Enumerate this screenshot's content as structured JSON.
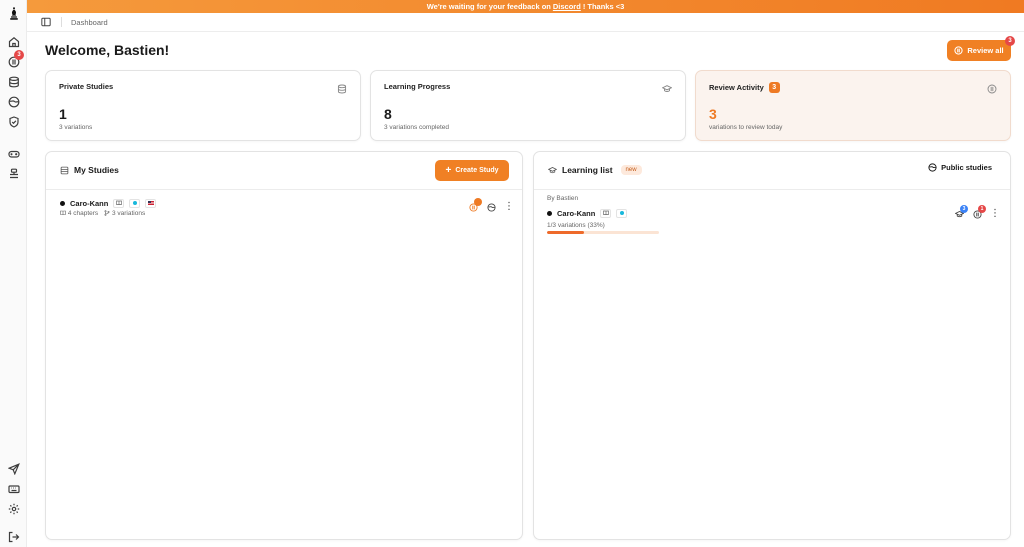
{
  "banner": {
    "text_before": "We're waiting for your feedback on",
    "link": "Discord",
    "text_after": "! Thanks <3"
  },
  "breadcrumb": "Dashboard",
  "welcome": "Welcome, Bastien!",
  "review_all": {
    "label": "Review all",
    "badge": "3"
  },
  "sidebar": {
    "notification_badge": "3"
  },
  "stats": {
    "private": {
      "title": "Private Studies",
      "value": "1",
      "sub": "3 variations"
    },
    "progress": {
      "title": "Learning Progress",
      "value": "8",
      "sub": "3 variations completed"
    },
    "review": {
      "title": "Review Activity",
      "badge": "3",
      "value": "3",
      "sub": "variations to review today"
    }
  },
  "my_studies": {
    "title": "My Studies",
    "create_label": "Create Study",
    "items": [
      {
        "name": "Caro-Kann",
        "chapters": "4 chapters",
        "variations": "3 variations"
      }
    ]
  },
  "learning_list": {
    "title": "Learning list",
    "new_label": "new",
    "public_label": "Public studies",
    "items": [
      {
        "author": "By Bastien",
        "name": "Caro-Kann",
        "progress_text": "1/3 variations (33%)",
        "progress": 0.33,
        "learn_badge": "3",
        "review_badge": "1"
      }
    ]
  },
  "colors": {
    "accent": "#f08024",
    "badge_red": "#e54848",
    "badge_blue": "#3b82f6"
  }
}
